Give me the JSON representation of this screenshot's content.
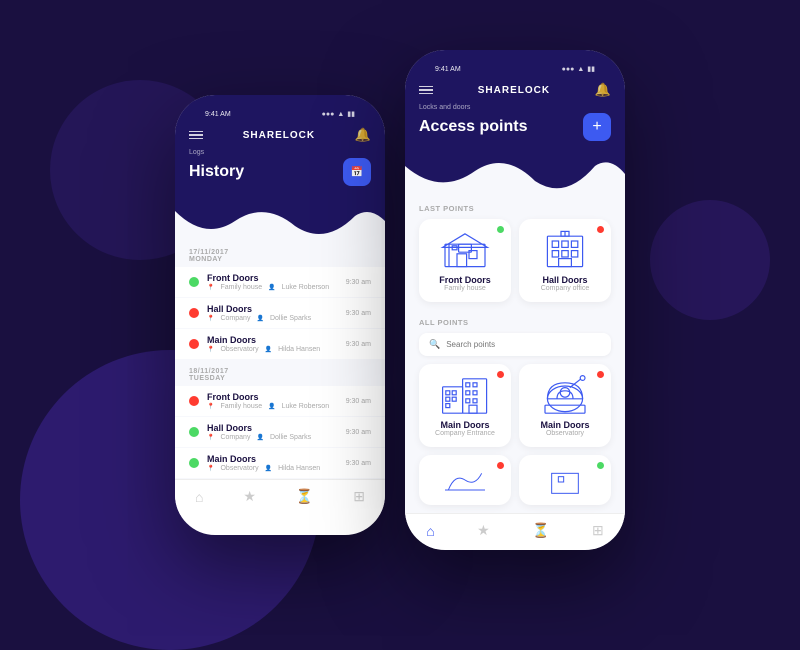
{
  "app": {
    "name": "SHARELOCK"
  },
  "left_phone": {
    "status_bar": {
      "time": "9:41 AM",
      "signal": "●●●",
      "wifi": "WiFi",
      "battery": "Battery"
    },
    "header": {
      "breadcrumb": "Logs",
      "title": "History",
      "menu_icon": "≡",
      "bell_icon": "🔔"
    },
    "sections": [
      {
        "date": "17/11/2017",
        "day": "MONDAY",
        "items": [
          {
            "name": "Front Doors",
            "location": "Family house",
            "user": "Luke Roberson",
            "time": "9:30 am",
            "status": "green"
          },
          {
            "name": "Hall Doors",
            "location": "Company",
            "user": "Dollie Sparks",
            "time": "9:30 am",
            "status": "red"
          },
          {
            "name": "Main Doors",
            "location": "Observatory",
            "user": "Hilda Hansen",
            "time": "9:30 am",
            "status": "red"
          }
        ]
      },
      {
        "date": "18/11/2017",
        "day": "TUESDAY",
        "items": [
          {
            "name": "Front Doors",
            "location": "Family house",
            "user": "Luke Roberson",
            "time": "9:30 am",
            "status": "green"
          },
          {
            "name": "Hall Doors",
            "location": "Company",
            "user": "Dollie Sparks",
            "time": "9:30 am",
            "status": "green"
          },
          {
            "name": "Main Doors",
            "location": "Observatory",
            "user": "Hilda Hansen",
            "time": "9:30 am",
            "status": "green"
          }
        ]
      }
    ],
    "nav": {
      "items": [
        "home",
        "star",
        "history",
        "settings"
      ]
    }
  },
  "right_phone": {
    "status_bar": {
      "time": "9:41 AM"
    },
    "header": {
      "breadcrumb": "Locks and doors",
      "title": "Access points",
      "menu_icon": "≡",
      "bell_icon": "🔔",
      "add_btn": "+"
    },
    "last_points_label": "LAST POINTS",
    "last_points": [
      {
        "name": "Front Doors",
        "sub": "Family house",
        "status": "green",
        "icon": "house"
      },
      {
        "name": "Hall Doors",
        "sub": "Company office",
        "status": "red",
        "icon": "office"
      }
    ],
    "all_points_label": "ALL POINTS",
    "search_placeholder": "Search points",
    "all_points": [
      {
        "name": "Main Doors",
        "sub": "Company Entrance",
        "status": "red",
        "icon": "buildings"
      },
      {
        "name": "Main Doors",
        "sub": "Observatory",
        "status": "red",
        "icon": "observatory"
      }
    ],
    "nav": {
      "items": [
        "home",
        "star",
        "history",
        "settings"
      ]
    }
  }
}
